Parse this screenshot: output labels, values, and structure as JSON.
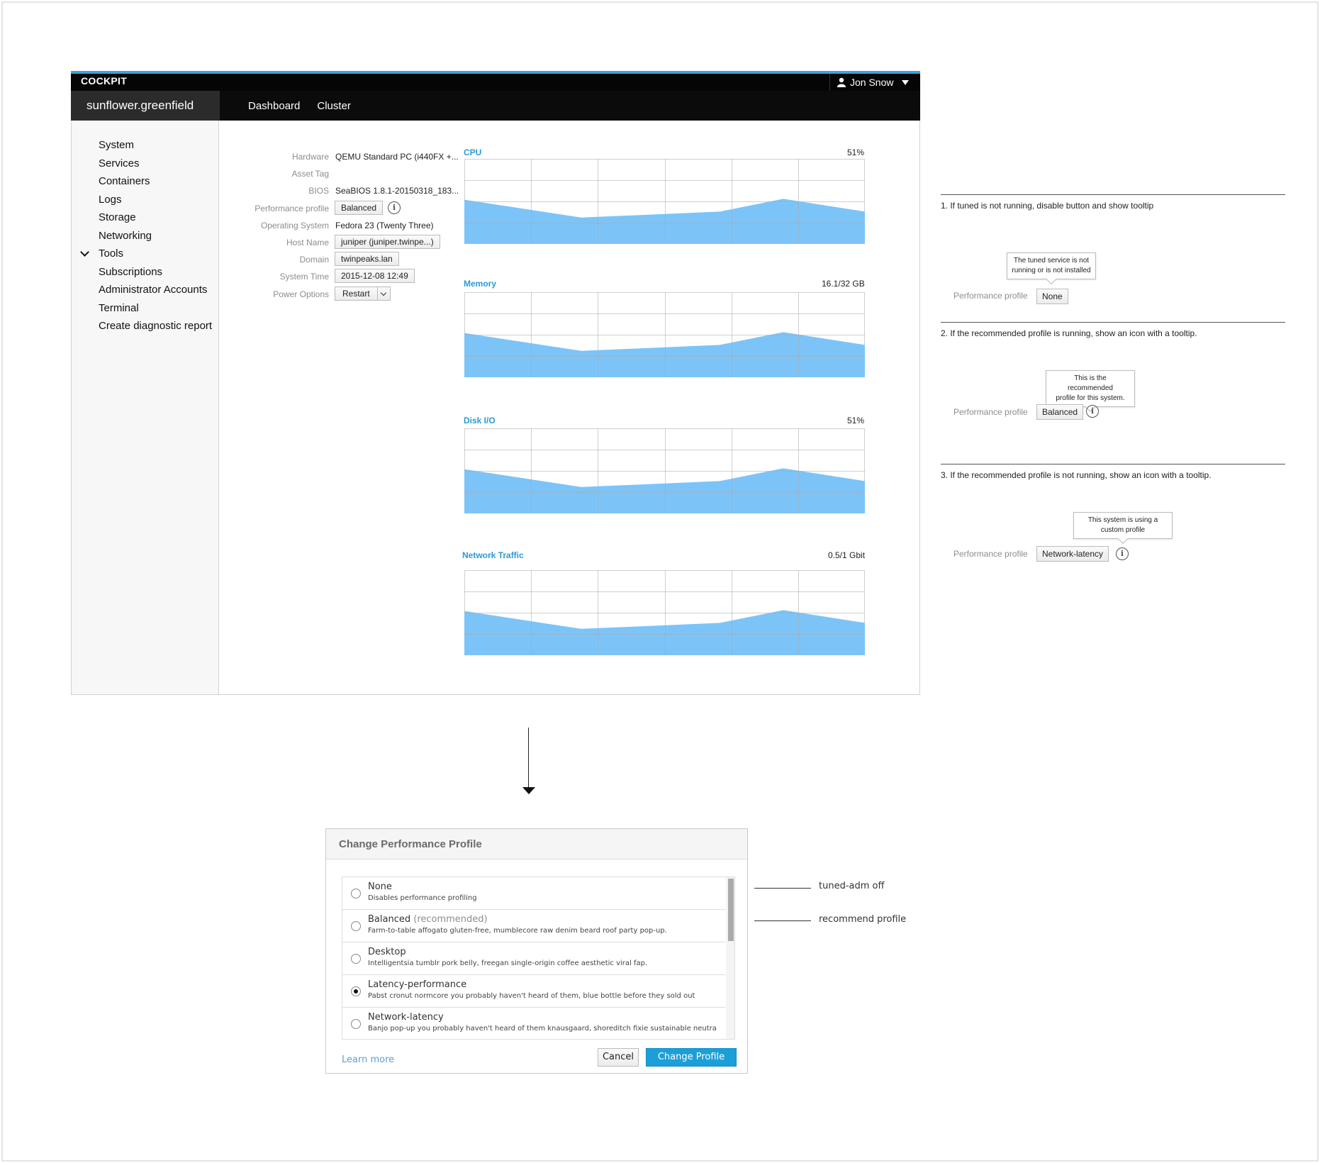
{
  "header": {
    "brand": "COCKPIT",
    "user": "Jon Snow"
  },
  "nav": {
    "host": "sunflower.greenfield",
    "links": [
      "Dashboard",
      "Cluster"
    ]
  },
  "sidebar": {
    "items": [
      "System",
      "Services",
      "Containers",
      "Logs",
      "Storage",
      "Networking",
      "Tools",
      "Subscriptions",
      "Administrator Accounts",
      "Terminal",
      "Create diagnostic report"
    ]
  },
  "system": {
    "hardware_label": "Hardware",
    "hardware": "QEMU Standard PC (i440FX +...",
    "asset_label": "Asset Tag",
    "bios_label": "BIOS",
    "bios": "SeaBIOS 1.8.1-20150318_183...",
    "perf_label": "Performance profile",
    "perf": "Balanced",
    "os_label": "Operating System",
    "os": "Fedora 23 (Twenty Three)",
    "host_label": "Host Name",
    "host": "juniper (juniper.twinpe...)",
    "domain_label": "Domain",
    "domain": "twinpeaks.lan",
    "time_label": "System Time",
    "time": "2015-12-08 12:49",
    "power_label": "Power Options",
    "power": "Restart"
  },
  "charts": [
    {
      "title": "CPU",
      "value": "51%"
    },
    {
      "title": "Memory",
      "value": "16.1/32 GB"
    },
    {
      "title": "Disk I/O",
      "value": "51%"
    },
    {
      "title": "Network Traffic",
      "value": "0.5/1 Gbit"
    }
  ],
  "chart_series": [
    0.52,
    0.31,
    0.38,
    0.53,
    0.38
  ],
  "annotations": {
    "a1": {
      "text": "1. If tuned is not running, disable button and show tooltip",
      "tip_l1": "The tuned service is not",
      "tip_l2": "running or is not installed",
      "label": "Performance profile",
      "button": "None"
    },
    "a2": {
      "text": "2. If the recommended profile is running, show an icon with a tooltip.",
      "tip_l1": "This is the recommended",
      "tip_l2": "profile for this system.",
      "label": "Performance profile",
      "button": "Balanced"
    },
    "a3": {
      "text": "3. If the recommended profile is not running, show an icon with a tooltip.",
      "tip_l1": "This system is using a",
      "tip_l2": "custom profile",
      "label": "Performance profile",
      "button": "Network-latency"
    }
  },
  "dialog": {
    "title": "Change Performance Profile",
    "options": [
      {
        "name": "None",
        "extra": "",
        "desc": "Disables performance profiling"
      },
      {
        "name": "Balanced",
        "extra": "(recommended)",
        "desc": "Farm-to-table affogato gluten-free, mumblecore raw denim beard roof party pop-up."
      },
      {
        "name": "Desktop",
        "extra": "",
        "desc": "Intelligentsia tumblr pork belly, freegan single-origin coffee aesthetic viral fap."
      },
      {
        "name": "Latency-performance",
        "extra": "",
        "desc": "Pabst cronut normcore you probably haven't heard of them, blue bottle before they sold out"
      },
      {
        "name": "Network-latency",
        "extra": "",
        "desc": "Banjo pop-up you probably haven't heard of them knausgaard, shoreditch fixie sustainable neutra"
      }
    ],
    "selected": "Latency-performance",
    "learn_more": "Learn more",
    "cancel": "Cancel",
    "submit": "Change Profile"
  },
  "callouts": {
    "c1": "tuned-adm off",
    "c2": "recommend profile"
  },
  "colors": {
    "accent": "#39a5dc",
    "chart_fill": "#7cc4f8",
    "primary": "#1c9fd8"
  }
}
